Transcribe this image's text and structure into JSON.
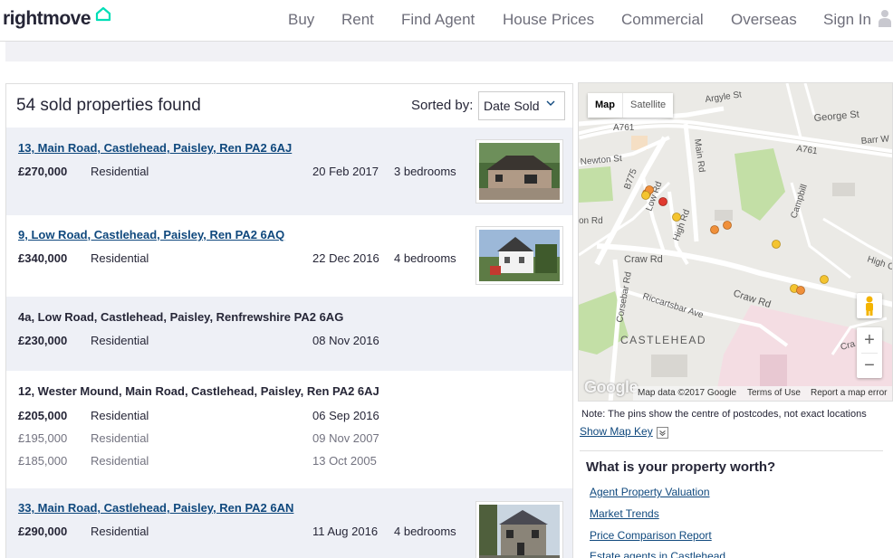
{
  "header": {
    "logo": "rightmove",
    "nav": [
      "Buy",
      "Rent",
      "Find Agent",
      "House Prices",
      "Commercial",
      "Overseas",
      "Sign In"
    ]
  },
  "results": {
    "title": "54 sold properties found",
    "sort_label": "Sorted by:",
    "sort_value": "Date Sold",
    "properties": [
      {
        "address": "13, Main Road, Castlehead, Paisley, Ren PA2 6AJ",
        "sales": [
          {
            "price": "£270,000",
            "type": "Residential",
            "date": "20 Feb 2017"
          }
        ],
        "bedrooms": "3 bedrooms"
      },
      {
        "address": "9, Low Road, Castlehead, Paisley, Ren PA2 6AQ",
        "sales": [
          {
            "price": "£340,000",
            "type": "Residential",
            "date": "22 Dec 2016"
          }
        ],
        "bedrooms": "4 bedrooms"
      },
      {
        "address": "4a, Low Road, Castlehead, Paisley, Renfrewshire PA2 6AG",
        "sales": [
          {
            "price": "£230,000",
            "type": "Residential",
            "date": "08 Nov 2016"
          }
        ]
      },
      {
        "address": "12, Wester Mound, Main Road, Castlehead, Paisley, Ren PA2 6AJ",
        "sales": [
          {
            "price": "£205,000",
            "type": "Residential",
            "date": "06 Sep 2016"
          },
          {
            "price": "£195,000",
            "type": "Residential",
            "date": "09 Nov 2007"
          },
          {
            "price": "£185,000",
            "type": "Residential",
            "date": "13 Oct 2005"
          }
        ]
      },
      {
        "address": "33, Main Road, Castlehead, Paisley, Ren PA2 6AN",
        "sales": [
          {
            "price": "£290,000",
            "type": "Residential",
            "date": "11 Aug 2016"
          }
        ],
        "bedrooms": "4 bedrooms"
      }
    ]
  },
  "map": {
    "type_map": "Map",
    "type_satellite": "Satellite",
    "streets": [
      "Argyle St",
      "George St",
      "Barr W",
      "A761",
      "A761",
      "Newton St",
      "B775",
      "Main Rd",
      "Low Rd",
      "High Rd",
      "Campbill",
      "on Rd",
      "Craw Rd",
      "Craw Rd",
      "High C",
      "Riccartsbar Ave",
      "Corsebar Rd",
      "Cra"
    ],
    "area_label": "CASTLEHEAD",
    "google": "Google",
    "footer_data": "Map data ©2017 Google",
    "footer_terms": "Terms of Use",
    "footer_report": "Report a map error",
    "zoom_in": "+",
    "zoom_out": "−",
    "note": "Note: The pins show the centre of postcodes, not exact locations",
    "show_key": "Show Map Key",
    "pin_colors": {
      "recent": "#f4c430",
      "mid": "#f0903a",
      "selected": "#e03a2f"
    }
  },
  "worth": {
    "title": "What is your property worth?",
    "links": [
      "Agent Property Valuation",
      "Market Trends",
      "Price Comparison Report",
      "Estate agents in Castlehead"
    ]
  },
  "colors": {
    "link": "#0f487d",
    "brand_accent": "#00deb6",
    "row_shade": "#eef0f6"
  }
}
